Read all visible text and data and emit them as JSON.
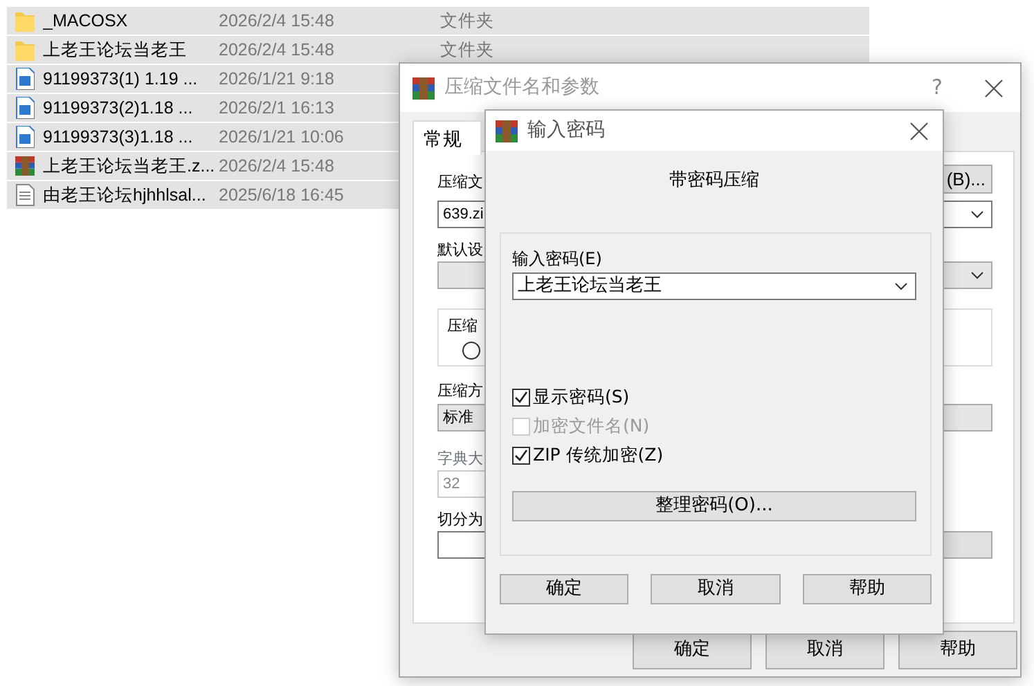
{
  "file_list": {
    "rows": [
      {
        "name": "_MACOSX",
        "date": "2026/2/4 15:48",
        "type": "文件夹",
        "kind": "folder",
        "selected": true
      },
      {
        "name": "上老王论坛当老王",
        "date": "2026/2/4 15:48",
        "type": "文件夹",
        "kind": "folder",
        "selected": true
      },
      {
        "name": "91199373(1) 1.19 ...",
        "date": "2026/1/21 9:18",
        "kind": "document",
        "selected": true
      },
      {
        "name": "91199373(2)1.18 ...",
        "date": "2026/2/1 16:13",
        "kind": "document",
        "selected": true
      },
      {
        "name": "91199373(3)1.18 ...",
        "date": "2026/1/21 10:06",
        "kind": "document",
        "selected": true
      },
      {
        "name": "上老王论坛当老王.z...",
        "date": "2026/2/4 15:48",
        "kind": "archive",
        "selected": true
      },
      {
        "name": "由老王论坛hjhhlsal...",
        "date": "2025/6/18 16:45",
        "kind": "text",
        "selected": true
      }
    ]
  },
  "archive_dialog": {
    "title": "压缩文件名和参数",
    "help": "?",
    "tabs": [
      {
        "label": "常规",
        "selected": true
      }
    ],
    "archive_name_label": "压缩文",
    "browse_button": "(B)...",
    "archive_name": "639.zi",
    "profile_label": "默认设",
    "format_label": "压缩",
    "format_option_selected": false,
    "method_label": "压缩方",
    "method": "标准",
    "dictionary_label": "字典大",
    "dictionary": "32",
    "split_label": "切分为",
    "buttons": [
      "确定",
      "取消",
      "帮助"
    ]
  },
  "password_dialog": {
    "title": "输入密码",
    "heading": "带密码压缩",
    "password_label": "输入密码(E)",
    "password": "上老王论坛当老王",
    "options": [
      {
        "label": "显示密码(S)",
        "checked": true,
        "disabled": false
      },
      {
        "label": "加密文件名(N)",
        "checked": false,
        "disabled": true
      },
      {
        "label": "ZIP 传统加密(Z)",
        "checked": true,
        "disabled": false
      }
    ],
    "organize_button": "整理密码(O)...",
    "buttons": [
      "确定",
      "取消",
      "帮助"
    ]
  }
}
